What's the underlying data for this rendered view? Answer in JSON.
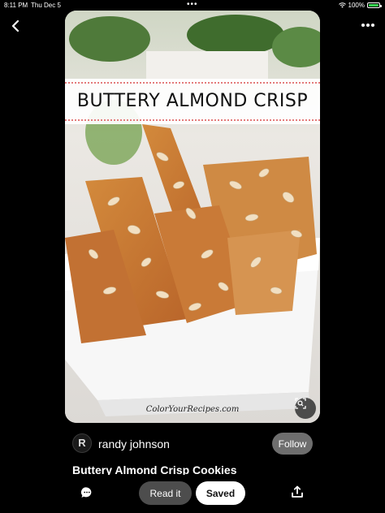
{
  "status_bar": {
    "time": "8:11 PM",
    "date": "Thu Dec 5",
    "battery": "100%",
    "battery_level": 1.0
  },
  "pin": {
    "banner_title": "BUTTERY ALMOND CRISP",
    "watermark": "ColorYourRecipes.com",
    "title": "Buttery Almond Crisp Cookies"
  },
  "author": {
    "initial": "R",
    "name": "randy johnson",
    "follow_label": "Follow"
  },
  "actions": {
    "read_it_label": "Read it",
    "saved_label": "Saved"
  },
  "icons": {
    "back": "chevron-left-icon",
    "more": "more-icon",
    "lens": "visual-search-icon",
    "comment": "comment-icon",
    "share": "share-icon"
  },
  "colors": {
    "background": "#000000",
    "follow_bg": "#6e6e6e",
    "read_it_bg": "#4d4d4d",
    "saved_bg": "#ffffff",
    "battery": "#39d353"
  }
}
